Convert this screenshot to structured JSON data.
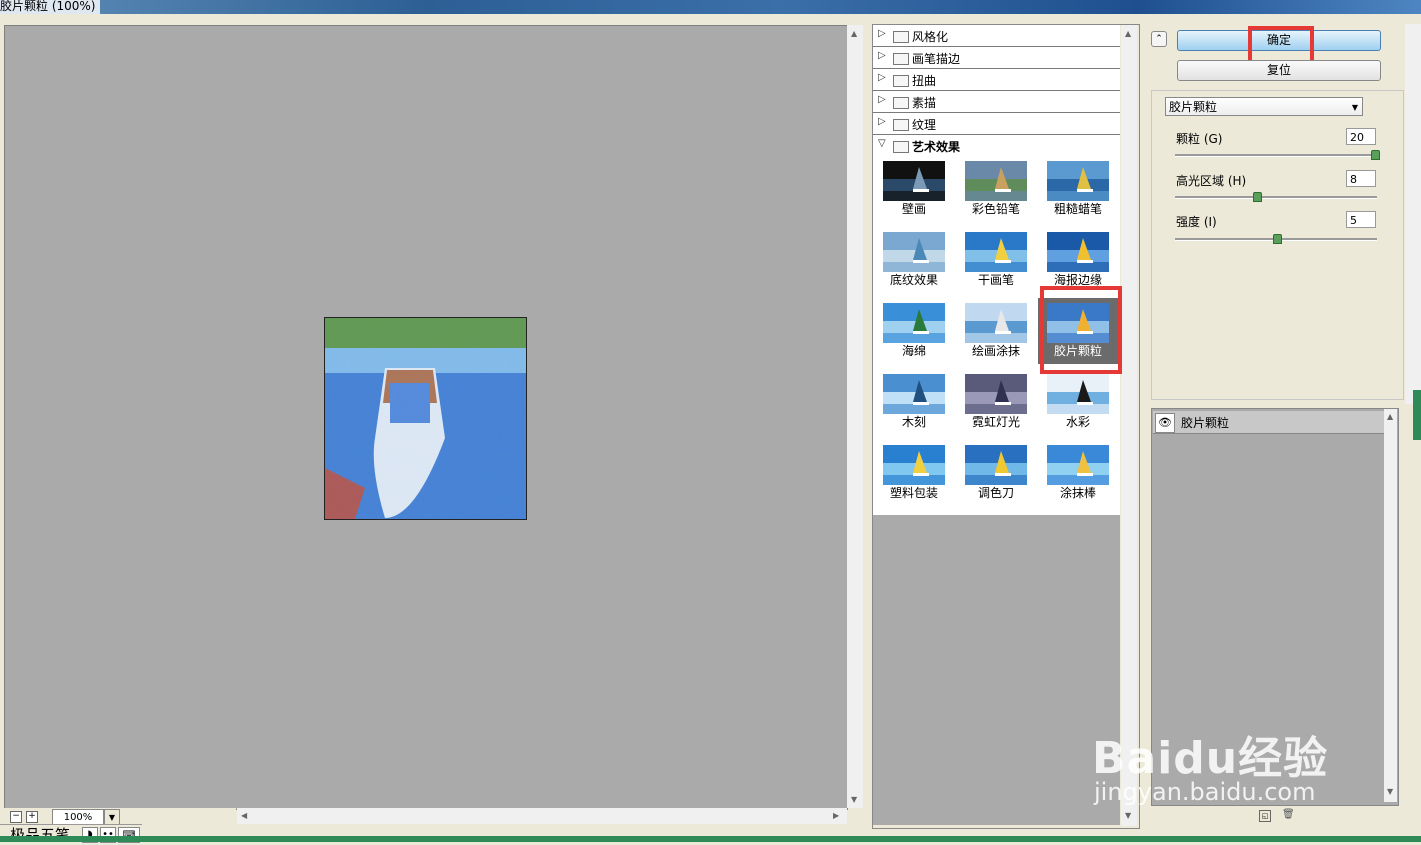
{
  "window": {
    "title": "胶片颗粒 (100%)"
  },
  "preview": {
    "zoom": "100%"
  },
  "ime": {
    "label": "极品五笔"
  },
  "gallery": {
    "categories": [
      {
        "label": "风格化",
        "expanded": false
      },
      {
        "label": "画笔描边",
        "expanded": false
      },
      {
        "label": "扭曲",
        "expanded": false
      },
      {
        "label": "素描",
        "expanded": false
      },
      {
        "label": "纹理",
        "expanded": false
      },
      {
        "label": "艺术效果",
        "expanded": true
      }
    ],
    "filters": [
      "壁画",
      "彩色铅笔",
      "粗糙蜡笔",
      "底纹效果",
      "干画笔",
      "海报边缘",
      "海绵",
      "绘画涂抹",
      "胶片颗粒",
      "木刻",
      "霓虹灯光",
      "水彩",
      "塑料包装",
      "调色刀",
      "涂抹棒"
    ],
    "selected": "胶片颗粒"
  },
  "buttons": {
    "ok": "确定",
    "reset": "复位"
  },
  "settings": {
    "selected_filter": "胶片颗粒",
    "params": [
      {
        "label": "颗粒 (G)",
        "value": "20",
        "fraction": 1.0
      },
      {
        "label": "高光区域 (H)",
        "value": "8",
        "fraction": 0.4
      },
      {
        "label": "强度 (I)",
        "value": "5",
        "fraction": 0.5
      }
    ]
  },
  "layers": {
    "items": [
      {
        "name": "胶片颗粒"
      }
    ]
  },
  "watermark": {
    "brand": "Baidu经验",
    "url": "jingyan.baidu.com"
  }
}
